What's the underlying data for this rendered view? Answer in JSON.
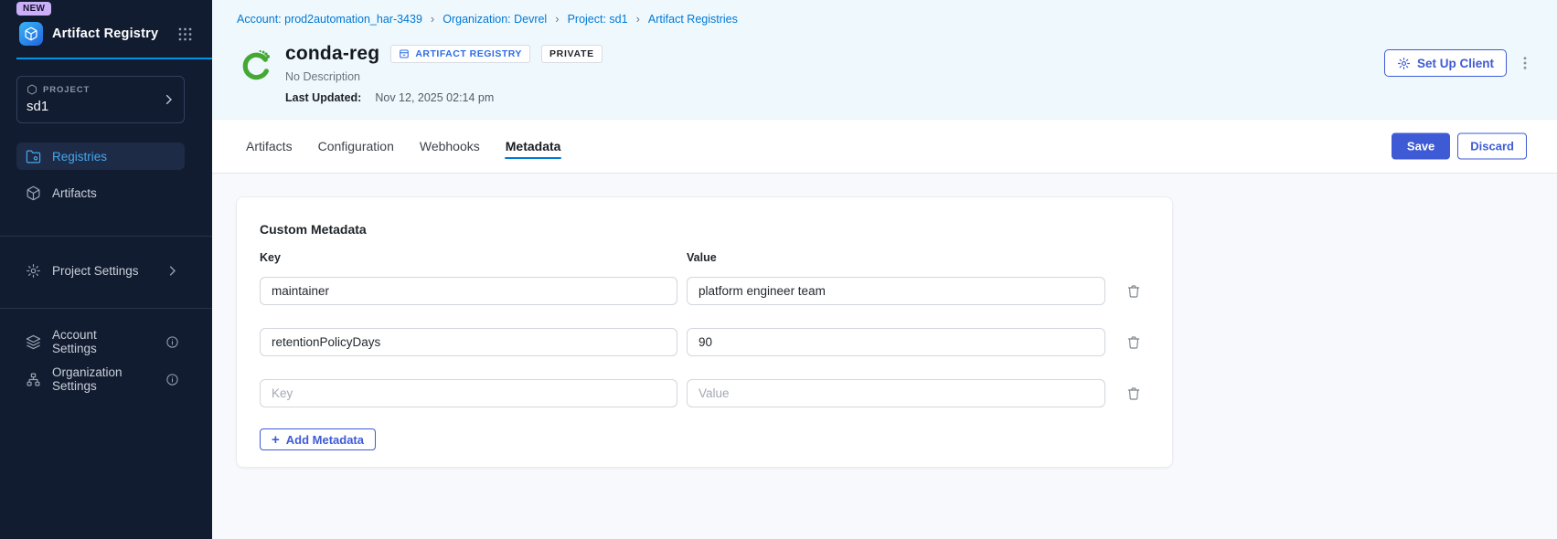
{
  "sidebar": {
    "new_badge": "NEW",
    "app_title": "Artifact Registry",
    "project": {
      "label": "PROJECT",
      "name": "sd1"
    },
    "nav": [
      {
        "label": "Registries"
      },
      {
        "label": "Artifacts"
      }
    ],
    "project_settings_label": "Project Settings",
    "account_settings_label": "Account Settings",
    "org_settings_label": "Organization Settings"
  },
  "breadcrumb": {
    "items": [
      "Account: prod2automation_har-3439",
      "Organization: Devrel",
      "Project: sd1",
      "Artifact Registries"
    ],
    "separator": "›"
  },
  "header": {
    "title": "conda-reg",
    "type_badge": "ARTIFACT REGISTRY",
    "visibility_badge": "PRIVATE",
    "description": "No Description",
    "last_updated_label": "Last Updated:",
    "last_updated_value": "Nov 12, 2025 02:14 pm",
    "setup_client_label": "Set Up Client"
  },
  "tabs": {
    "items": [
      "Artifacts",
      "Configuration",
      "Webhooks",
      "Metadata"
    ],
    "active": "Metadata",
    "save_label": "Save",
    "discard_label": "Discard"
  },
  "metadata": {
    "section_title": "Custom Metadata",
    "key_header": "Key",
    "value_header": "Value",
    "rows": [
      {
        "key": "maintainer",
        "value": "platform engineer team"
      },
      {
        "key": "retentionPolicyDays",
        "value": "90"
      },
      {
        "key": "",
        "value": "",
        "key_placeholder": "Key",
        "value_placeholder": "Value"
      }
    ],
    "add_button_plus": "+",
    "add_button_label": "Add Metadata"
  },
  "colors": {
    "link_blue": "#0278d5",
    "button_blue": "#3e5bd5",
    "sidebar_bg": "#111c30",
    "active_nav_text": "#45a7ee",
    "conda_green": "#44a833",
    "new_badge_bg": "#cbb0f7",
    "header_band_bg": "#eef8fd"
  }
}
